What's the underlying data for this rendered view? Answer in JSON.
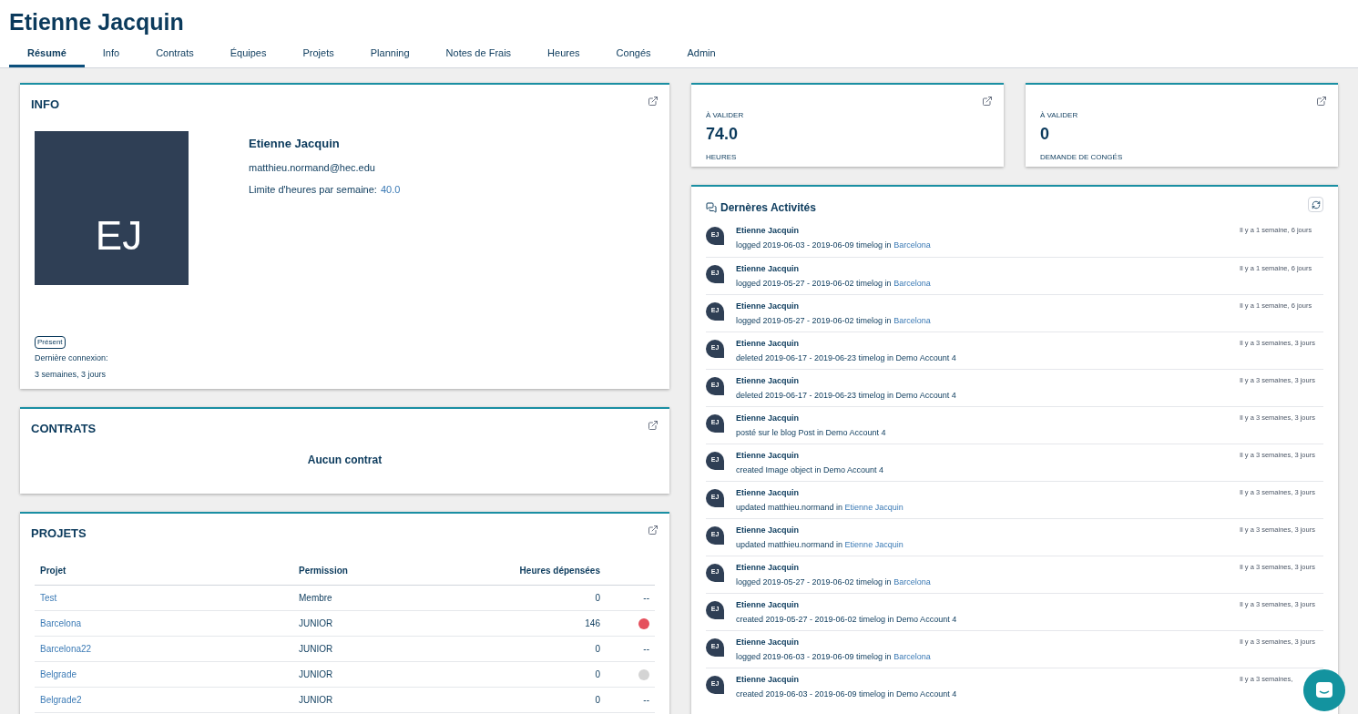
{
  "header": {
    "title": "Etienne Jacquin"
  },
  "tabs": [
    {
      "label": "Résumé",
      "selected": true
    },
    {
      "label": "Info",
      "selected": false
    },
    {
      "label": "Contrats",
      "selected": false
    },
    {
      "label": "Équipes",
      "selected": false
    },
    {
      "label": "Projets",
      "selected": false
    },
    {
      "label": "Planning",
      "selected": false
    },
    {
      "label": "Notes de Frais",
      "selected": false
    },
    {
      "label": "Heures",
      "selected": false
    },
    {
      "label": "Congés",
      "selected": false
    },
    {
      "label": "Admin",
      "selected": false
    }
  ],
  "info": {
    "title": "INFO",
    "initials": "EJ",
    "name": "Etienne Jacquin",
    "email": "matthieu.normand@hec.edu",
    "limit_label": "Limite d'heures par semaine:",
    "limit_value": "40.0",
    "presence": "Présent",
    "last_login_label": "Dernière connexion:",
    "last_login": "3 semaines, 3 jours"
  },
  "contrats": {
    "title": "CONTRATS",
    "empty": "Aucun contrat"
  },
  "projets": {
    "title": "PROJETS",
    "columns": [
      "Projet",
      "Permission",
      "Heures dépensées"
    ],
    "rows": [
      {
        "project": "Test",
        "permission": "Membre",
        "hours": "0",
        "kind": "dash",
        "mark": "--"
      },
      {
        "project": "Barcelona",
        "permission": "JUNIOR",
        "hours": "146",
        "kind": "dot",
        "color": "#e5505d"
      },
      {
        "project": "Barcelona22",
        "permission": "JUNIOR",
        "hours": "0",
        "kind": "dash",
        "mark": "--"
      },
      {
        "project": "Belgrade",
        "permission": "JUNIOR",
        "hours": "0",
        "kind": "dot",
        "color": "#d4d4d4"
      },
      {
        "project": "Belgrade2",
        "permission": "JUNIOR",
        "hours": "0",
        "kind": "dash",
        "mark": "--"
      }
    ]
  },
  "stats": [
    {
      "label": "À VALIDER",
      "value": "74.0",
      "caption": "HEURES"
    },
    {
      "label": "À VALIDER",
      "value": "0",
      "caption": "DEMANDE DE CONGÉS"
    }
  ],
  "activities": {
    "title": "Dernères Activités",
    "items": [
      {
        "initials": "EJ",
        "name": "Etienne Jacquin",
        "text": "logged 2019-06-03 - 2019-06-09 timelog in",
        "link": "Barcelona",
        "time": "Il y a 1 semaine, 6 jours"
      },
      {
        "initials": "EJ",
        "name": "Etienne Jacquin",
        "text": "logged 2019-05-27 - 2019-06-02 timelog in",
        "link": "Barcelona",
        "time": "Il y a 1 semaine, 6 jours"
      },
      {
        "initials": "EJ",
        "name": "Etienne Jacquin",
        "text": "logged 2019-05-27 - 2019-06-02 timelog in",
        "link": "Barcelona",
        "time": "Il y a 1 semaine, 6 jours"
      },
      {
        "initials": "EJ",
        "name": "Etienne Jacquin",
        "text": "deleted 2019-06-17 - 2019-06-23 timelog in Demo Account 4",
        "time": "Il y a 3 semaines, 3 jours"
      },
      {
        "initials": "EJ",
        "name": "Etienne Jacquin",
        "text": "deleted 2019-06-17 - 2019-06-23 timelog in Demo Account 4",
        "time": "Il y a 3 semaines, 3 jours"
      },
      {
        "initials": "EJ",
        "name": "Etienne Jacquin",
        "text": "posté sur le blog Post in Demo Account 4",
        "time": "Il y a 3 semaines, 3 jours"
      },
      {
        "initials": "EJ",
        "name": "Etienne Jacquin",
        "text": "created Image object in Demo Account 4",
        "time": "Il y a 3 semaines, 3 jours"
      },
      {
        "initials": "EJ",
        "name": "Etienne Jacquin",
        "text": "updated matthieu.normand in",
        "link": "Etienne Jacquin",
        "time": "Il y a 3 semaines, 3 jours"
      },
      {
        "initials": "EJ",
        "name": "Etienne Jacquin",
        "text": "updated matthieu.normand in",
        "link": "Etienne Jacquin",
        "time": "Il y a 3 semaines, 3 jours"
      },
      {
        "initials": "EJ",
        "name": "Etienne Jacquin",
        "text": "logged 2019-05-27 - 2019-06-02 timelog in",
        "link": "Barcelona",
        "time": "Il y a 3 semaines, 3 jours"
      },
      {
        "initials": "EJ",
        "name": "Etienne Jacquin",
        "text": "created 2019-05-27 - 2019-06-02 timelog in Demo Account 4",
        "time": "Il y a 3 semaines, 3 jours"
      },
      {
        "initials": "EJ",
        "name": "Etienne Jacquin",
        "text": "logged 2019-06-03 - 2019-06-09 timelog in",
        "link": "Barcelona",
        "time": "Il y a 3 semaines, 3 jours"
      },
      {
        "initials": "EJ",
        "name": "Etienne Jacquin",
        "text": "created 2019-06-03 - 2019-06-09 timelog in Demo Account 4",
        "time": "Il y a 3 semaines,"
      }
    ]
  }
}
